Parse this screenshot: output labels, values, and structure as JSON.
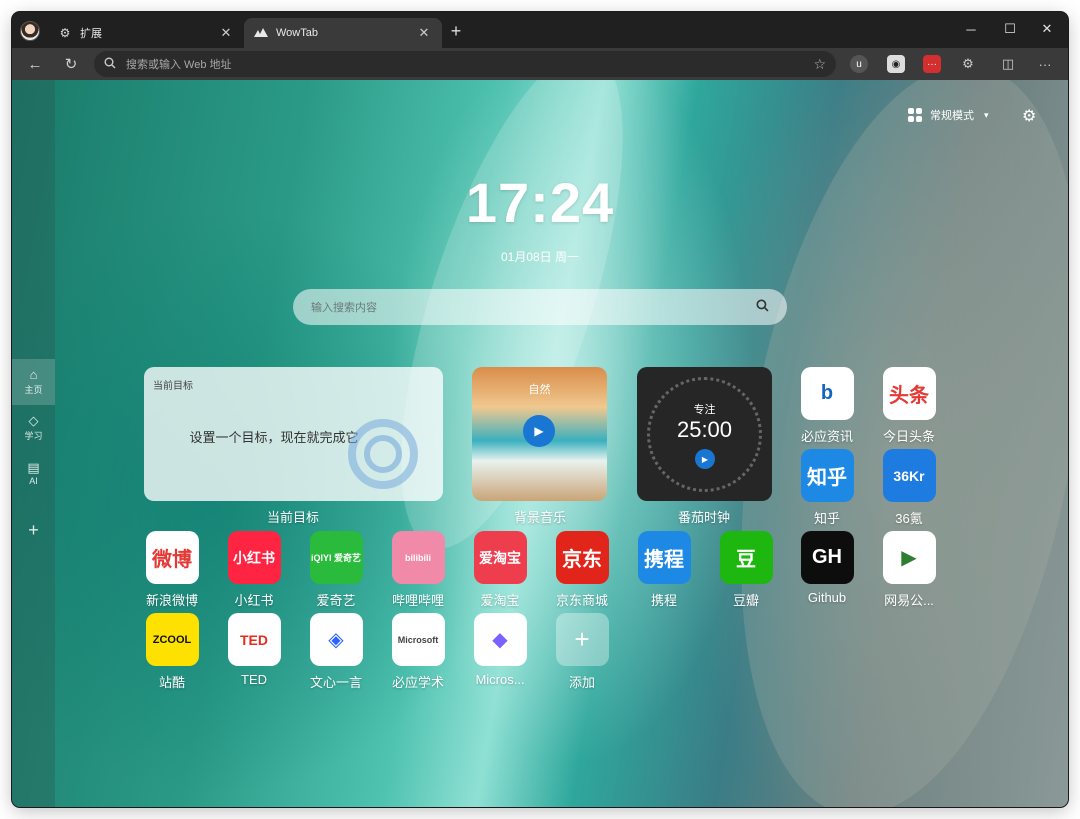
{
  "browser": {
    "tabs": [
      {
        "label": "扩展",
        "icon": "puzzle-icon"
      },
      {
        "label": "WowTab",
        "icon": "wowtab-logo-icon"
      }
    ],
    "address_placeholder": "搜索或输入 Web 地址"
  },
  "page": {
    "mode_label": "常规模式",
    "time": "17:24",
    "date": "01月08日 周一",
    "search_placeholder": "输入搜索内容"
  },
  "sidebar": {
    "items": [
      {
        "label": "主页",
        "icon": "home-icon"
      },
      {
        "label": "学习",
        "icon": "graduation-cap-icon"
      },
      {
        "label": "AI",
        "icon": "robot-icon"
      }
    ]
  },
  "widgets": {
    "goal": {
      "title": "当前目标",
      "text": "设置一个目标，现在就完成它",
      "label": "当前目标"
    },
    "music": {
      "title": "自然",
      "label": "背景音乐"
    },
    "pomodoro": {
      "title": "专注",
      "time": "25:00",
      "label": "番茄时钟"
    }
  },
  "apps": [
    {
      "label": "必应资讯",
      "tile_text": "b",
      "bg": "#ffffff",
      "fg": "#1565c0"
    },
    {
      "label": "今日头条",
      "tile_text": "头条",
      "bg": "#ffffff",
      "fg": "#e53935"
    },
    {
      "label": "知乎",
      "tile_text": "知乎",
      "bg": "#1e88e5",
      "fg": "#ffffff"
    },
    {
      "label": "36氪",
      "tile_text": "36Kr",
      "bg": "#1e7be0",
      "fg": "#ffffff"
    },
    {
      "label": "新浪微博",
      "tile_text": "微博",
      "bg": "#ffffff",
      "fg": "#e53935"
    },
    {
      "label": "小红书",
      "tile_text": "小红书",
      "bg": "#ff2442",
      "fg": "#ffffff"
    },
    {
      "label": "爱奇艺",
      "tile_text": "iQIYI 爱奇艺",
      "bg": "#2bbb3c",
      "fg": "#ffffff"
    },
    {
      "label": "哔哩哔哩",
      "tile_text": "bilibili",
      "bg": "#f189a8",
      "fg": "#ffffff"
    },
    {
      "label": "爱淘宝",
      "tile_text": "爱淘宝",
      "bg": "#ee3e4e",
      "fg": "#ffffff"
    },
    {
      "label": "京东商城",
      "tile_text": "京东",
      "bg": "#e1251b",
      "fg": "#ffffff"
    },
    {
      "label": "携程",
      "tile_text": "携程",
      "bg": "#1e88e5",
      "fg": "#ffffff"
    },
    {
      "label": "豆瓣",
      "tile_text": "豆",
      "bg": "#1db70f",
      "fg": "#ffffff"
    },
    {
      "label": "Github",
      "tile_text": "GH",
      "bg": "#0d0d0d",
      "fg": "#ffffff"
    },
    {
      "label": "网易公...",
      "tile_text": "▶",
      "bg": "#ffffff",
      "fg": "#2e7d32"
    },
    {
      "label": "站酷",
      "tile_text": "ZCOOL",
      "bg": "#ffe100",
      "fg": "#111111"
    },
    {
      "label": "TED",
      "tile_text": "TED",
      "bg": "#ffffff",
      "fg": "#e62b1e"
    },
    {
      "label": "文心一言",
      "tile_text": "◈",
      "bg": "#ffffff",
      "fg": "#2962ff"
    },
    {
      "label": "必应学术",
      "tile_text": "Microsoft",
      "bg": "#ffffff",
      "fg": "#444444"
    },
    {
      "label": "Micros...",
      "tile_text": "◆",
      "bg": "#ffffff",
      "fg": "#7b61ff"
    },
    {
      "label": "添加",
      "tile_text": "+",
      "bg": "rgba(255,255,255,0.35)",
      "fg": "#ffffff"
    }
  ]
}
